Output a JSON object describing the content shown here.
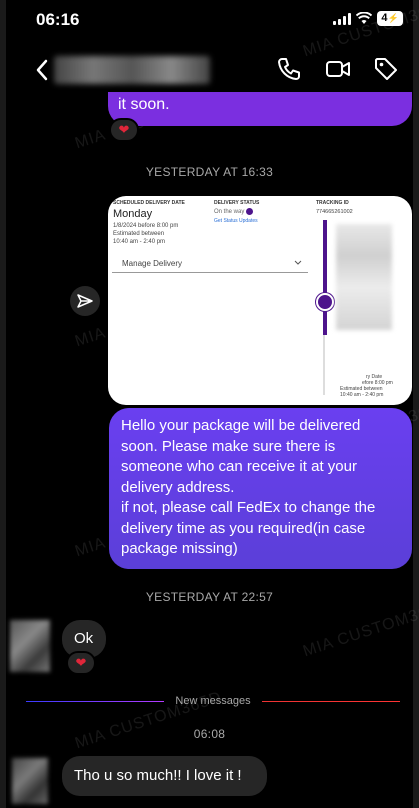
{
  "status_bar": {
    "time": "06:16",
    "battery": "4"
  },
  "header": {
    "back_icon": "chevron-left-icon",
    "call_icon": "phone-icon",
    "video_icon": "video-camera-icon",
    "tag_icon": "tag-icon"
  },
  "watermark": "MIA CUSTOM365D",
  "messages": {
    "top_bubble_text": "it soon.",
    "divider_1": "YESTERDAY AT 16:33",
    "card": {
      "scheduled_label": "SCHEDULED DELIVERY DATE",
      "day": "Monday",
      "date_line": "1/8/2024 before 8:00 pm",
      "est_label": "Estimated between",
      "est_time": "10:40 am - 2:40 pm",
      "status_label": "DELIVERY STATUS",
      "status": "On the way",
      "status_link": "Get Status Updates",
      "manage": "Manage Delivery",
      "tracking_label": "TRACKING ID",
      "tracking_id": "774665261002",
      "bottom_1": "ry Date",
      "bottom_2": "efore 8:00 pm",
      "bottom_3": "Estimated between",
      "bottom_4": "10:40 am - 2:40 pm"
    },
    "main_text": "Hello your package will be delivered soon. Please make sure there is someone who can receive it at your delivery address.\nif not, please call FedEx to change the delivery time as you required(in case package missing)",
    "divider_2": "YESTERDAY AT 22:57",
    "reply_1": "Ok",
    "new_messages": "New messages",
    "divider_3": "06:08",
    "reply_2": "Tho u so much!! I love it !"
  },
  "colors": {
    "accent": "#7b2fe0",
    "bubble_gray": "#262626",
    "heart": "#e0263a",
    "fedex_purple": "#4d148c"
  }
}
